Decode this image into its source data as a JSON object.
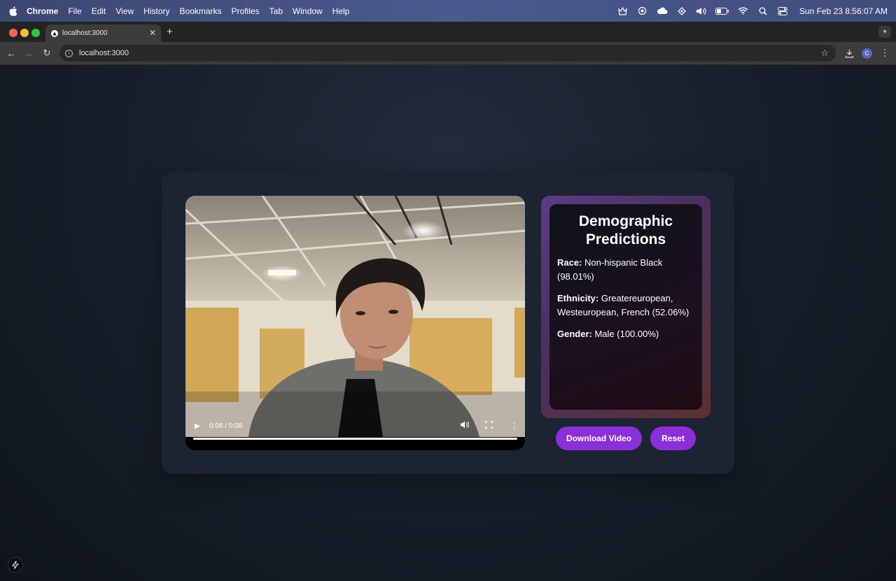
{
  "menubar": {
    "items": [
      "Chrome",
      "File",
      "Edit",
      "View",
      "History",
      "Bookmarks",
      "Profiles",
      "Tab",
      "Window",
      "Help"
    ],
    "clock": "Sun Feb 23  8:56:07 AM"
  },
  "browser": {
    "tab_title": "localhost:3000",
    "url": "localhost:3000",
    "profile_initial": "C"
  },
  "video": {
    "time": "0:08 / 0:08",
    "progress": 1.0
  },
  "predictions": {
    "title": "Demographic Predictions",
    "race_label": "Race:",
    "race_value": "Non-hispanic Black (98.01%)",
    "ethnicity_label": "Ethnicity:",
    "ethnicity_value": "Greatereuropean, Westeuropean, French (52.06%)",
    "gender_label": "Gender:",
    "gender_value": "Male (100.00%)"
  },
  "actions": {
    "download_label": "Download Video",
    "reset_label": "Reset"
  },
  "colors": {
    "accent": "#8b2fd9",
    "card": "#1b2430"
  }
}
